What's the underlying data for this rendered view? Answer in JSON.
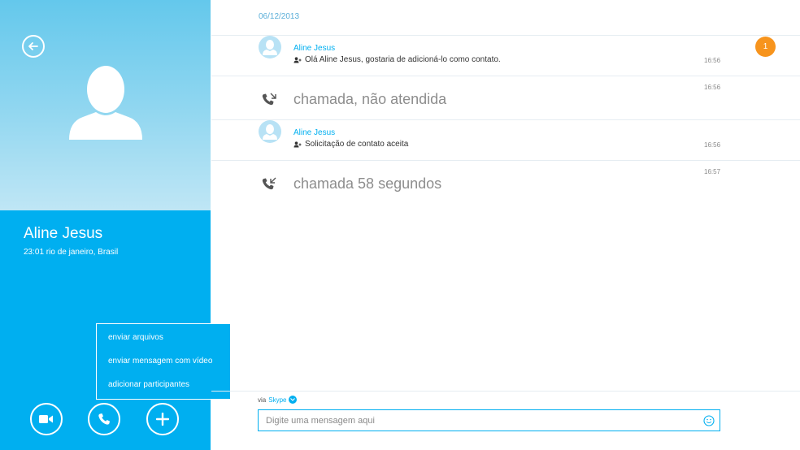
{
  "contact": {
    "name": "Aline Jesus",
    "location": "23:01 rio de janeiro, Brasil"
  },
  "menu": {
    "items": [
      "enviar arquivos",
      "enviar mensagem com vídeo",
      "adicionar participantes"
    ]
  },
  "actions": {
    "video_icon": "video-camera-icon",
    "phone_icon": "phone-icon",
    "add_icon": "plus-icon"
  },
  "conversation": {
    "date": "06/12/2013",
    "unread_badge": "1",
    "messages": [
      {
        "type": "contact",
        "name": "Aline Jesus",
        "text": "Olá Aline Jesus, gostaria de adicioná-lo como contato.",
        "time": "16:56"
      },
      {
        "type": "call",
        "text": "chamada, não atendida",
        "time": "16:56"
      },
      {
        "type": "contact",
        "name": "Aline Jesus",
        "text": "Solicitação de contato aceita",
        "time": "16:56"
      },
      {
        "type": "call",
        "text": "chamada  58 segundos",
        "time": "16:57"
      }
    ]
  },
  "compose": {
    "via_label": "via",
    "via_service": "Skype",
    "placeholder": "Digite uma mensagem aqui"
  },
  "colors": {
    "accent": "#00aff0",
    "badge": "#f7941d"
  }
}
